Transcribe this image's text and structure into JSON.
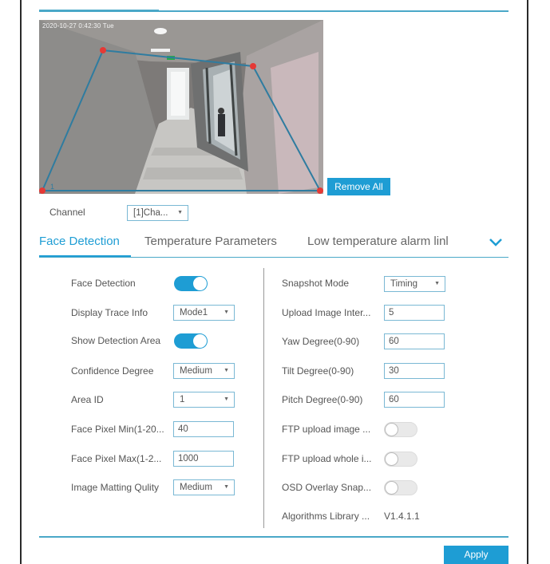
{
  "preview": {
    "timestamp": "2020-10-27 0:42:30 Tue",
    "area_label": "1"
  },
  "buttons": {
    "remove_all": "Remove All",
    "apply": "Apply"
  },
  "channel": {
    "label": "Channel",
    "value": "[1]Cha..."
  },
  "tabs": [
    {
      "label": "Face Detection",
      "active": true
    },
    {
      "label": "Temperature Parameters",
      "active": false
    },
    {
      "label": "Low temperature alarm linl",
      "active": false
    }
  ],
  "left_column": {
    "face_detection": {
      "label": "Face Detection",
      "enabled": true
    },
    "display_trace_info": {
      "label": "Display Trace Info",
      "value": "Mode1"
    },
    "show_detection_area": {
      "label": "Show Detection Area",
      "enabled": true
    },
    "confidence_degree": {
      "label": "Confidence Degree",
      "value": "Medium"
    },
    "area_id": {
      "label": "Area ID",
      "value": "1"
    },
    "face_pixel_min": {
      "label": "Face Pixel Min(1-20...",
      "value": "40"
    },
    "face_pixel_max": {
      "label": "Face Pixel Max(1-2...",
      "value": "1000"
    },
    "image_matting_quality": {
      "label": "Image Matting Qulity",
      "value": "Medium"
    }
  },
  "right_column": {
    "snapshot_mode": {
      "label": "Snapshot Mode",
      "value": "Timing"
    },
    "upload_image_interval": {
      "label": "Upload Image Inter...",
      "value": "5"
    },
    "yaw_degree": {
      "label": "Yaw Degree(0-90)",
      "value": "60"
    },
    "tilt_degree": {
      "label": "Tilt Degree(0-90)",
      "value": "30"
    },
    "pitch_degree": {
      "label": "Pitch Degree(0-90)",
      "value": "60"
    },
    "ftp_upload_image": {
      "label": "FTP upload image ...",
      "enabled": false
    },
    "ftp_upload_whole": {
      "label": "FTP upload whole i...",
      "enabled": false
    },
    "osd_overlay_snap": {
      "label": "OSD Overlay Snap...",
      "enabled": false
    },
    "algorithms_library": {
      "label": "Algorithms Library ...",
      "value": "V1.4.1.1"
    }
  },
  "colors": {
    "accent": "#1e9dd4",
    "line": "#4aa8c8",
    "toggle_off": "#e9e9e9"
  },
  "icons": {
    "tabs_more": "chevron-down-icon",
    "select_caret": "caret-down-icon"
  }
}
